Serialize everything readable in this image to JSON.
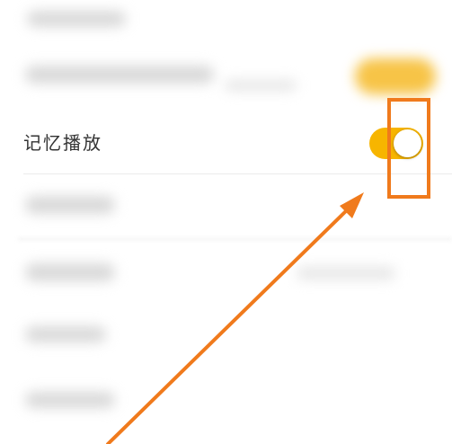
{
  "settings": {
    "memory_playback": {
      "label": "记忆播放",
      "enabled": true
    }
  },
  "colors": {
    "toggle_on": "#f7b500",
    "annotation": "#f07a1c",
    "label_text": "#333333"
  },
  "annotation": {
    "highlight_box": "memory-playback-toggle",
    "arrow_icon": "arrow-pointer-icon"
  }
}
